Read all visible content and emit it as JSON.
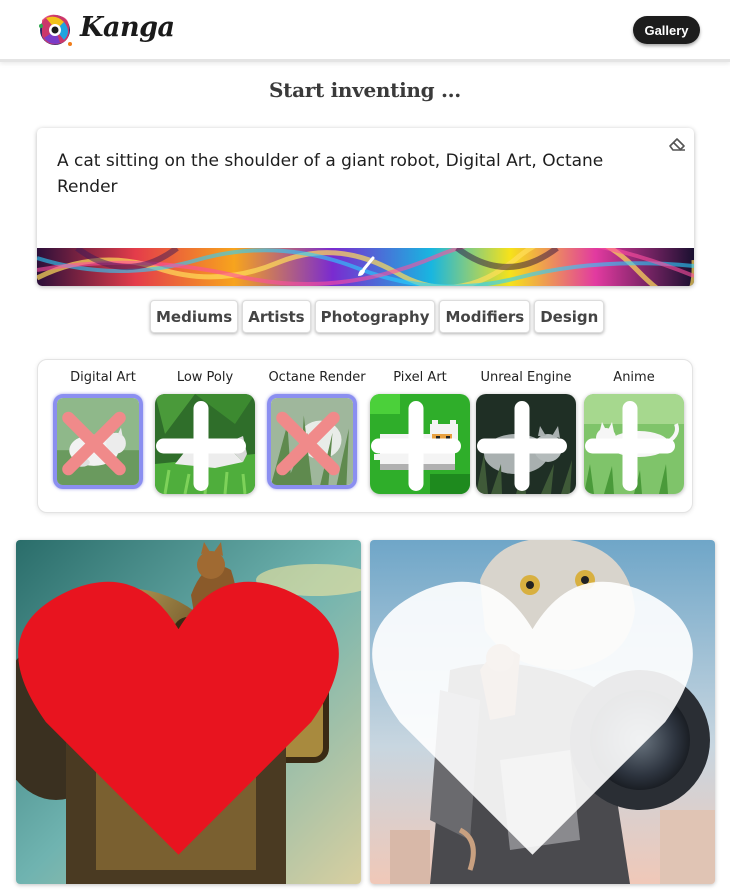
{
  "header": {
    "brand": "Kanga",
    "gallery_label": "Gallery",
    "logo_icon": "paint-splash-logo-icon"
  },
  "page": {
    "title": "Start inventing ..."
  },
  "prompt": {
    "text": "A cat sitting on the shoulder of a giant robot, Digital Art, Octane Render",
    "clear_icon": "eraser-icon",
    "generate_icon": "paintbrush-icon"
  },
  "categories": [
    "Mediums",
    "Artists",
    "Photography",
    "Modifiers",
    "Design"
  ],
  "styles": [
    {
      "label": "Digital Art",
      "selected": true,
      "badge": "remove-x-icon"
    },
    {
      "label": "Low Poly",
      "selected": false,
      "badge": "add-plus-icon"
    },
    {
      "label": "Octane Render",
      "selected": true,
      "badge": "remove-x-icon"
    },
    {
      "label": "Pixel Art",
      "selected": false,
      "badge": "add-plus-icon"
    },
    {
      "label": "Unreal Engine",
      "selected": false,
      "badge": "add-plus-icon"
    },
    {
      "label": "Anime",
      "selected": false,
      "badge": "add-plus-icon"
    }
  ],
  "results": [
    {
      "favorited": true,
      "heart_color": "#e8141f"
    },
    {
      "favorited": false,
      "heart_color": "#ffffff"
    }
  ],
  "colors": {
    "accent_selected": "#8b8ff0",
    "button_dark": "#1d1d1d",
    "remove_badge": "#f08a8a"
  }
}
